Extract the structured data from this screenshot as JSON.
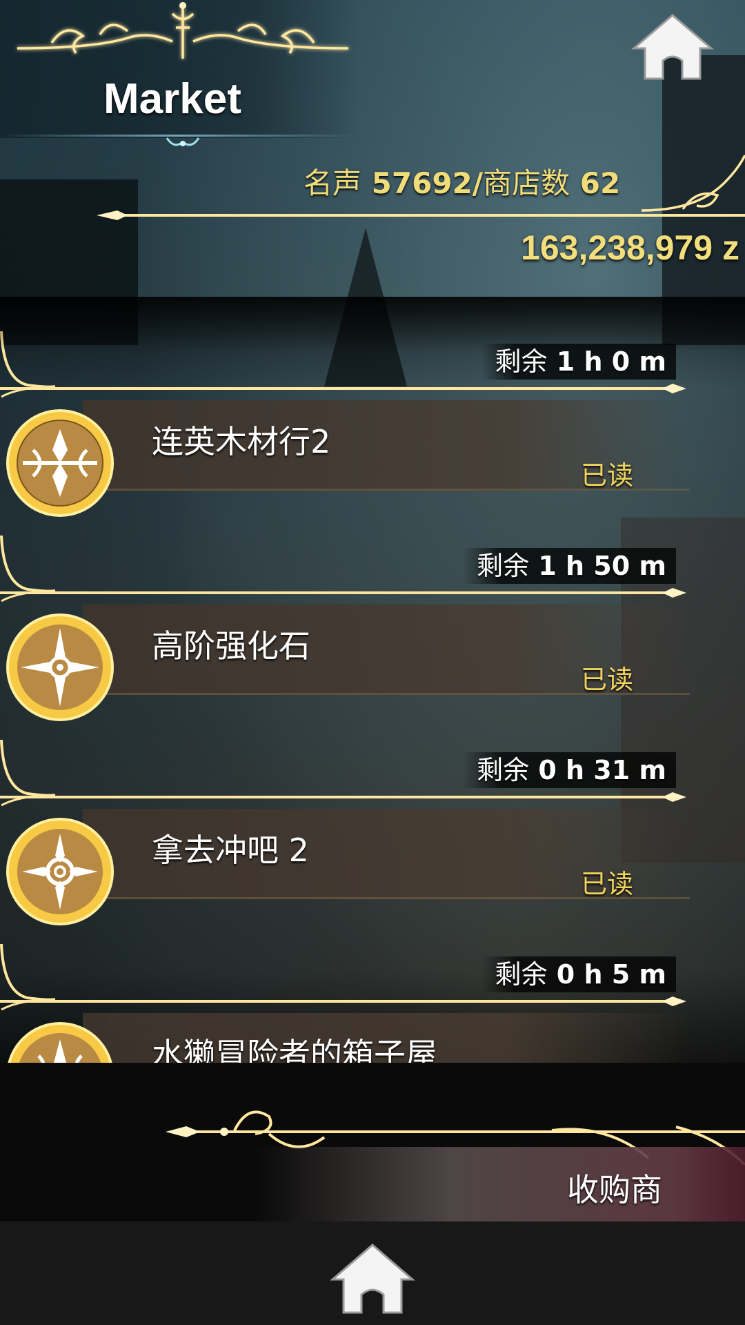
{
  "header": {
    "title": "Market",
    "reputation_label": "名声",
    "reputation_value": "57692/",
    "shop_count_label": "商店数",
    "shop_count_value": "62",
    "money": "163,238,979 z"
  },
  "items": [
    {
      "remaining_label": "剩余",
      "remaining_value": "1 h 0 m",
      "name": "连英木材行2",
      "status": "已读",
      "icon": "wood-emblem-icon"
    },
    {
      "remaining_label": "剩余",
      "remaining_value": "1 h 50 m",
      "name": "高阶强化石",
      "status": "已读",
      "icon": "compass-emblem-icon"
    },
    {
      "remaining_label": "剩余",
      "remaining_value": "0 h 31 m",
      "name": "拿去冲吧 2",
      "status": "已读",
      "icon": "ring-emblem-icon"
    },
    {
      "remaining_label": "剩余",
      "remaining_value": "0 h 5 m",
      "name": "水獭冒险者的箱子屋",
      "status": "",
      "icon": "emblem-icon"
    }
  ],
  "bottom": {
    "buyer_label": "收购商"
  },
  "icons": {
    "home_top": "home-icon",
    "home_bottom": "home-icon"
  },
  "colors": {
    "gold": "#f3de7d",
    "status_yellow": "#f2d45c",
    "glow": "#ffd86b"
  }
}
